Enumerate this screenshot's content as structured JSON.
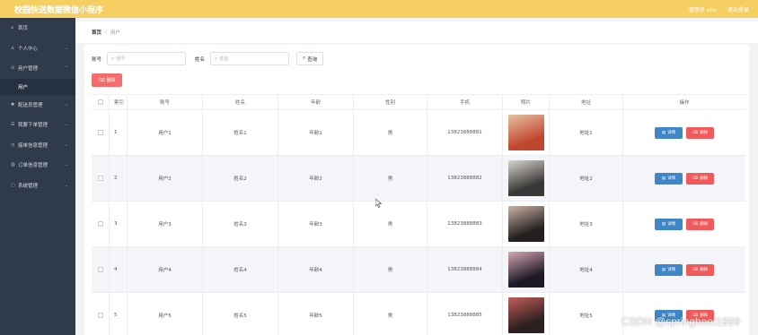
{
  "topbar": {
    "title": "校园快送数据微信小程序",
    "admin_text": "管理员 abo",
    "logout_text": "退出登录"
  },
  "sidebar": {
    "items": [
      {
        "label": "首页",
        "icon": "home-icon"
      },
      {
        "label": "个人中心",
        "icon": "user-icon"
      },
      {
        "label": "用户管理",
        "icon": "location-icon"
      },
      {
        "label": "用户",
        "icon": ""
      },
      {
        "label": "配送员管理",
        "icon": "settings-icon"
      },
      {
        "label": "我要下单管理",
        "icon": "list-icon"
      },
      {
        "label": "接单信息管理",
        "icon": "clock-icon"
      },
      {
        "label": "订单信息管理",
        "icon": "chart-icon"
      },
      {
        "label": "系统管理",
        "icon": "document-icon"
      }
    ]
  },
  "breadcrumb": {
    "home": "首页",
    "separator": "/",
    "current": "用户"
  },
  "search": {
    "account_label": "账号",
    "account_placeholder": "账号",
    "name_label": "姓名",
    "name_placeholder": "姓名",
    "query_button": "查询"
  },
  "toolbar": {
    "delete_button": "删除"
  },
  "table": {
    "headers": [
      "",
      "索引",
      "账号",
      "姓名",
      "年龄",
      "性别",
      "手机",
      "照片",
      "地址",
      "操作"
    ],
    "rows": [
      {
        "index": "1",
        "account": "用户1",
        "name": "姓名1",
        "age": "年龄1",
        "sex": "男",
        "phone": "13823888881",
        "address": "地址1",
        "photo_colors": [
          "#c0472f",
          "#e7c3a4"
        ]
      },
      {
        "index": "2",
        "account": "用户2",
        "name": "姓名2",
        "age": "年龄2",
        "sex": "男",
        "phone": "13823888882",
        "address": "地址2",
        "photo_colors": [
          "#3a3836",
          "#d8d4cf"
        ]
      },
      {
        "index": "3",
        "account": "用户3",
        "name": "姓名3",
        "age": "年龄3",
        "sex": "男",
        "phone": "13823888883",
        "address": "地址3",
        "photo_colors": [
          "#24201f",
          "#c9b3a8"
        ]
      },
      {
        "index": "4",
        "account": "用户4",
        "name": "姓名4",
        "age": "年龄4",
        "sex": "男",
        "phone": "13823888884",
        "address": "地址4",
        "photo_colors": [
          "#1d1a26",
          "#d5a7b3"
        ]
      },
      {
        "index": "5",
        "account": "用户5",
        "name": "姓名5",
        "age": "年龄5",
        "sex": "男",
        "phone": "13823888885",
        "address": "地址5",
        "photo_colors": [
          "#2b2020",
          "#c25e5a"
        ]
      }
    ],
    "detail_button": "详情",
    "delete_button": "删除"
  },
  "watermark": "CSDN @springboot1999",
  "colors": {
    "topbar": "#f6cf62",
    "sidebar": "#2f3a4a",
    "detail_button": "#3f86c6",
    "delete_button": "#f05a5a"
  }
}
